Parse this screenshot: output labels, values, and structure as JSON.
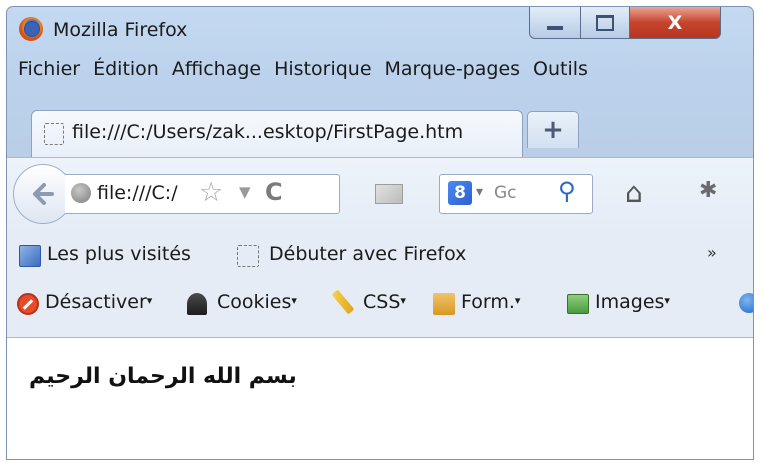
{
  "window": {
    "title": "Mozilla Firefox",
    "controls": {
      "minimize": "",
      "maximize": "",
      "close": "X"
    }
  },
  "menubar": {
    "items": [
      "Fichier",
      "Édition",
      "Affichage",
      "Historique",
      "Marque-pages",
      "Outils"
    ]
  },
  "tabs": {
    "active_label": "file:///C:/Users/zak...esktop/FirstPage.htm",
    "new_tab_label": "+"
  },
  "navbar": {
    "url": "file:///C:/",
    "search_placeholder": "Gc",
    "search_engine_icon": "8"
  },
  "bookmarks": {
    "items": [
      {
        "label": "Les plus visités",
        "icon": "bookmark-icon"
      },
      {
        "label": "Débuter avec Firefox",
        "icon": "blank-page-icon"
      }
    ],
    "more": "»"
  },
  "webdev_toolbar": {
    "items": [
      {
        "label": "Désactiver",
        "icon": "disable-icon"
      },
      {
        "label": "Cookies",
        "icon": "cookie-icon"
      },
      {
        "label": "CSS",
        "icon": "css-wand-icon"
      },
      {
        "label": "Form.",
        "icon": "form-icon"
      },
      {
        "label": "Images",
        "icon": "image-icon"
      }
    ]
  },
  "page": {
    "text": "بسم الله الرحمان الرحيم"
  },
  "colors": {
    "titlebar": "#c4d9f1",
    "close_button": "#c7442c",
    "content_bg": "#ffffff"
  }
}
